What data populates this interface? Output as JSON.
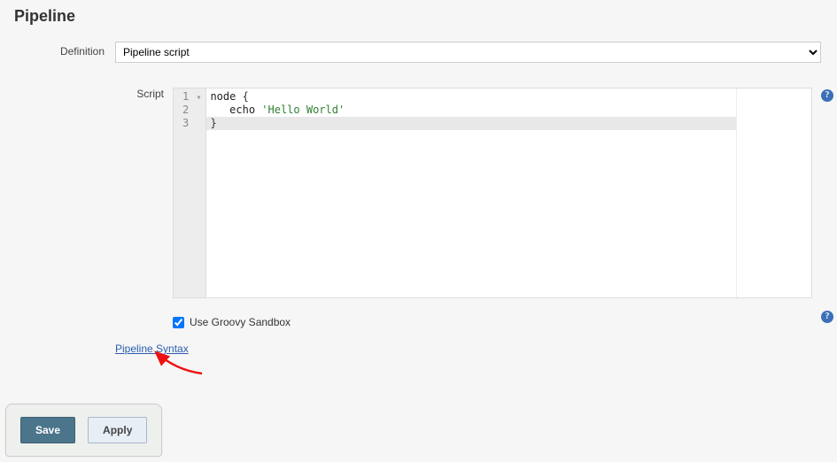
{
  "section": {
    "heading": "Pipeline"
  },
  "definition": {
    "label": "Definition",
    "selected": "Pipeline script"
  },
  "script": {
    "label": "Script",
    "lines": [
      {
        "num": "1",
        "fold": "▾",
        "text_plain": "node {",
        "text_html": "<span class='kw'>node</span> {"
      },
      {
        "num": "2",
        "fold": "",
        "text_plain": "   echo 'Hello World'",
        "text_html": "   <span class='kw'>echo</span> <span class='str'>'Hello World'</span>"
      },
      {
        "num": "3",
        "fold": "",
        "text_plain": "}",
        "text_html": "}",
        "active": true
      }
    ]
  },
  "sandbox": {
    "label": "Use Groovy Sandbox",
    "checked": true
  },
  "link": {
    "pipeline_syntax": "Pipeline Syntax"
  },
  "buttons": {
    "save": "Save",
    "apply": "Apply"
  },
  "icons": {
    "help_glyph": "?"
  }
}
